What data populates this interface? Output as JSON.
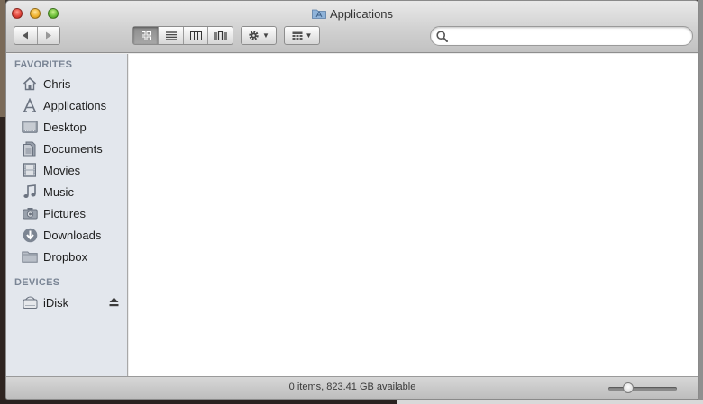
{
  "window": {
    "title": "Applications"
  },
  "search": {
    "placeholder": "",
    "value": ""
  },
  "sidebar": {
    "favorites_heading": "FAVORITES",
    "favorites": [
      {
        "label": "Chris",
        "icon": "home-icon"
      },
      {
        "label": "Applications",
        "icon": "applications-icon"
      },
      {
        "label": "Desktop",
        "icon": "desktop-icon"
      },
      {
        "label": "Documents",
        "icon": "documents-icon"
      },
      {
        "label": "Movies",
        "icon": "movies-icon"
      },
      {
        "label": "Music",
        "icon": "music-icon"
      },
      {
        "label": "Pictures",
        "icon": "camera-icon"
      },
      {
        "label": "Downloads",
        "icon": "downloads-icon"
      },
      {
        "label": "Dropbox",
        "icon": "folder-icon"
      }
    ],
    "devices_heading": "DEVICES",
    "devices": [
      {
        "label": "iDisk",
        "icon": "disk-icon"
      }
    ]
  },
  "statusbar": {
    "text": "0 items, 823.41 GB available"
  },
  "zoom": {
    "level": 0.25
  },
  "colors": {
    "sidebar_bg": "#e3e7ed",
    "section_heading": "#7a8595"
  }
}
